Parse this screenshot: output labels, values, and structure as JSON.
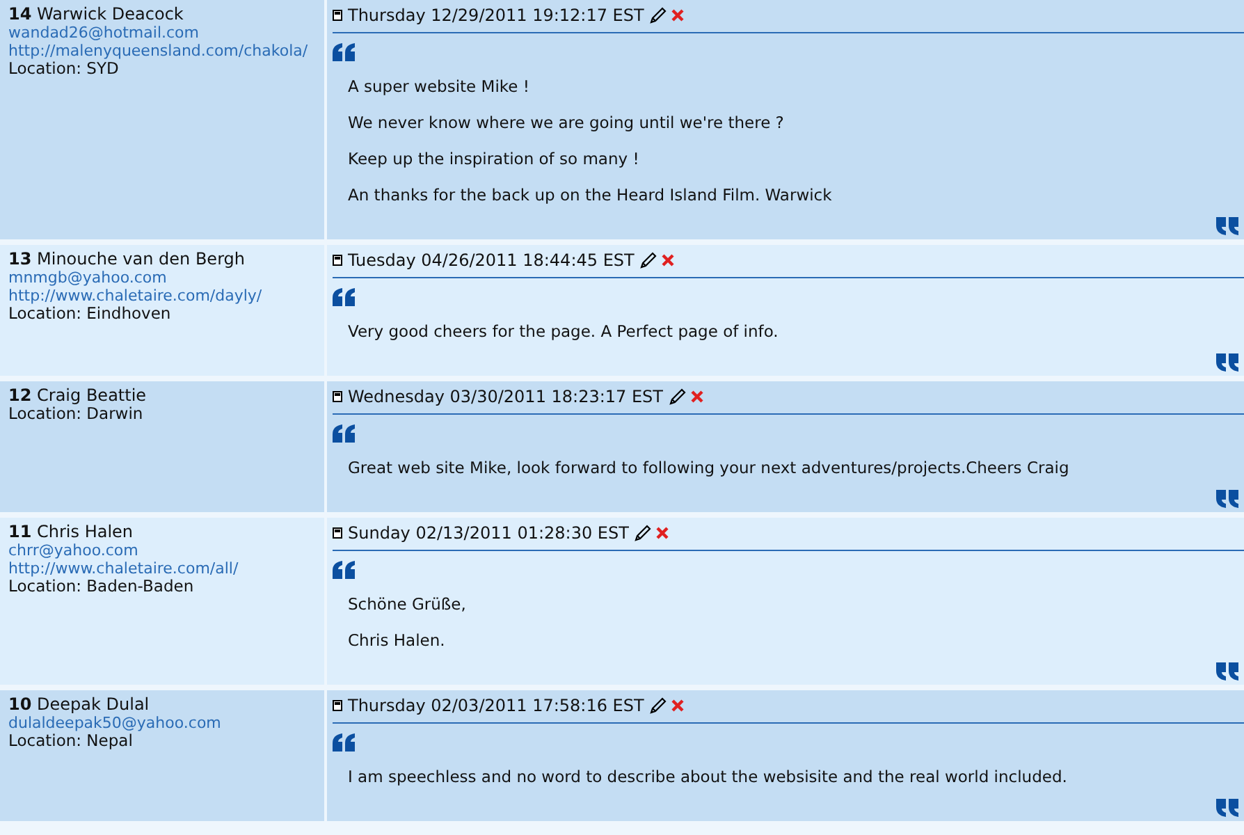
{
  "entries": [
    {
      "number": "14",
      "name": "Warwick Deacock",
      "email": "wandad26@hotmail.com",
      "website": "http://malenyqueensland.com/chakola/",
      "location": "Location: SYD",
      "date": "Thursday 12/29/2011 19:12:17 EST",
      "paragraphs": [
        "A super website Mike !",
        "We never know where we are going until we're there ?",
        "Keep up the inspiration of so many !",
        "An thanks for the back up on the Heard Island Film. Warwick"
      ]
    },
    {
      "number": "13",
      "name": "Minouche van den Bergh",
      "email": "mnmgb@yahoo.com",
      "website": "http://www.chaletaire.com/dayly/",
      "location": "Location: Eindhoven",
      "date": "Tuesday 04/26/2011 18:44:45 EST",
      "paragraphs": [
        "Very good cheers for the page. A Perfect page of info."
      ]
    },
    {
      "number": "12",
      "name": "Craig Beattie",
      "location": "Location: Darwin",
      "date": "Wednesday 03/30/2011 18:23:17 EST",
      "paragraphs": [
        "Great web site Mike, look forward to following your next adventures/projects.Cheers Craig"
      ]
    },
    {
      "number": "11",
      "name": "Chris Halen",
      "email": "chrr@yahoo.com",
      "website": "http://www.chaletaire.com/all/",
      "location": "Location: Baden-Baden",
      "date": "Sunday 02/13/2011 01:28:30 EST",
      "paragraphs": [
        "Schöne Grüße,",
        "Chris Halen."
      ]
    },
    {
      "number": "10",
      "name": "Deepak Dulal",
      "email": "dulaldeepak50@yahoo.com",
      "location": "Location: Nepal",
      "date": "Thursday 02/03/2011 17:58:16 EST",
      "paragraphs": [
        "I am speechless and no word to describe about the websisite and the real world included."
      ]
    }
  ]
}
